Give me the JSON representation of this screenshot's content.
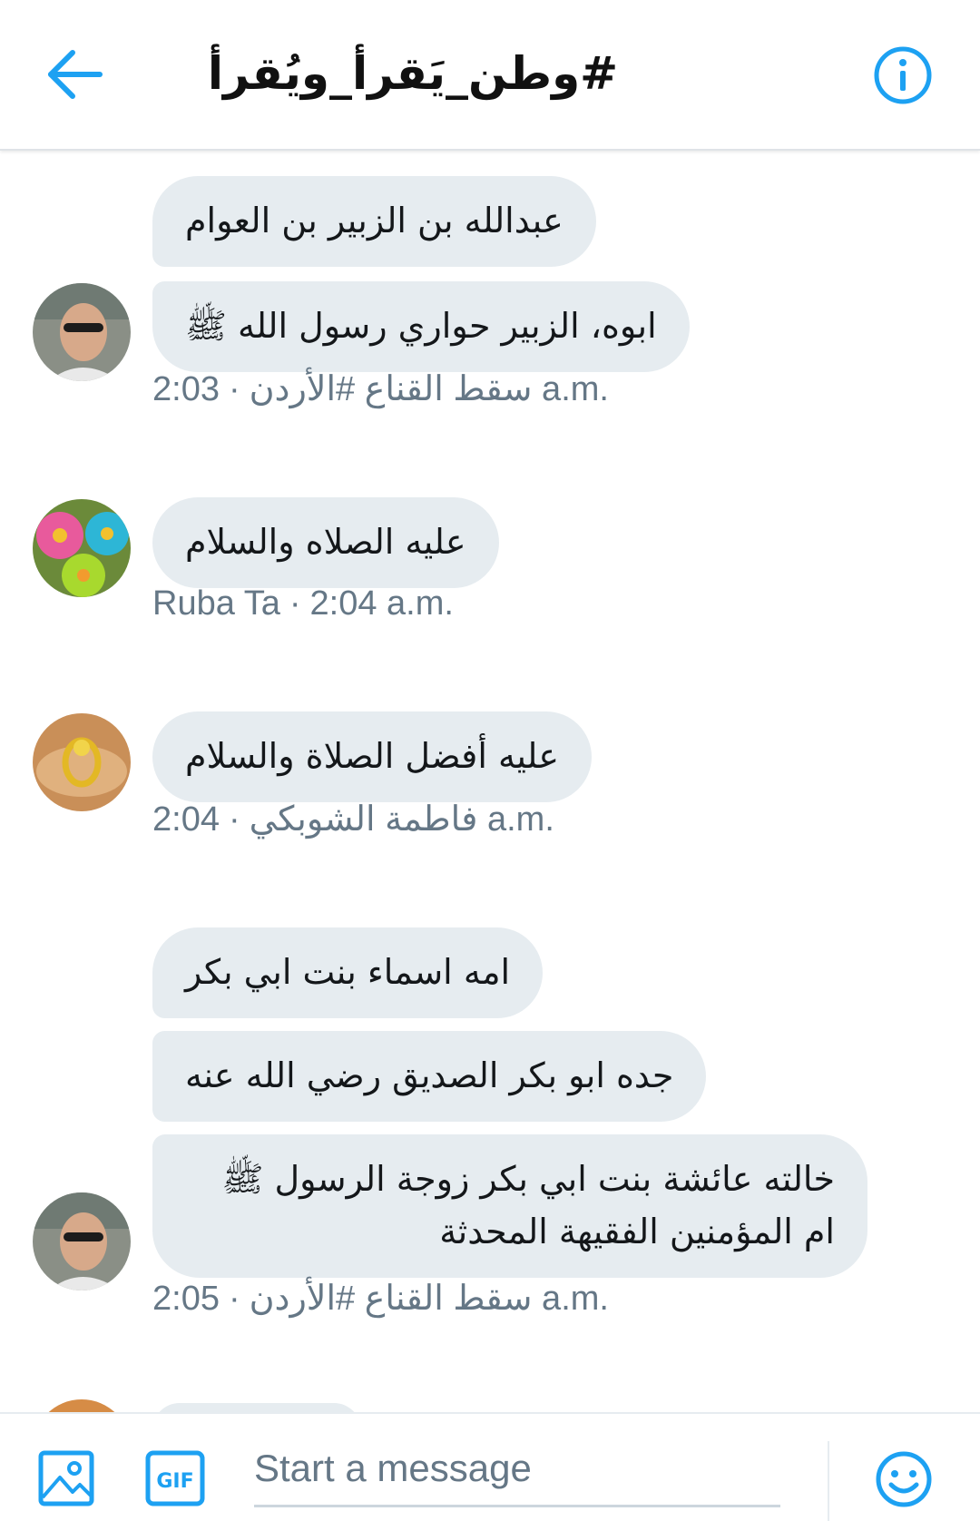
{
  "header": {
    "title": "#وطن_يَقرأ_ويُقرأ",
    "back_icon": "arrow-left-icon",
    "info_icon": "info-circle-icon",
    "accent_color": "#1da1f2"
  },
  "messages": [
    {
      "bubbles": [
        "عبدالله بن الزبير بن العوام",
        "ابوه، الزبير حواري رسول الله ﷺ"
      ],
      "sender": "سقط القناع #الأردن",
      "time": "2:03 a.m."
    },
    {
      "bubbles": [
        "عليه الصلاه والسلام"
      ],
      "sender": "Ruba Ta",
      "time": "2:04 a.m."
    },
    {
      "bubbles": [
        "عليه أفضل الصلاة والسلام"
      ],
      "sender": "فاطمة الشوبكي",
      "time": "2:04 a.m."
    },
    {
      "bubbles": [
        "امه اسماء بنت ابي بكر",
        "جده ابو بكر الصديق رضي الله عنه",
        "خالته عائشة بنت ابي بكر زوجة الرسول ﷺ ام المؤمنين الفقيهة المحدثة"
      ],
      "sender": "سقط القناع #الأردن",
      "time": "2:05 a.m."
    }
  ],
  "meta_separator": "·",
  "composer": {
    "placeholder": "Start a message",
    "image_icon": "image-icon",
    "gif_label": "GIF",
    "emoji_icon": "smiley-icon"
  },
  "colors": {
    "bubble_bg": "#e6ecf0",
    "meta_text": "#657786",
    "accent": "#1da1f2"
  }
}
